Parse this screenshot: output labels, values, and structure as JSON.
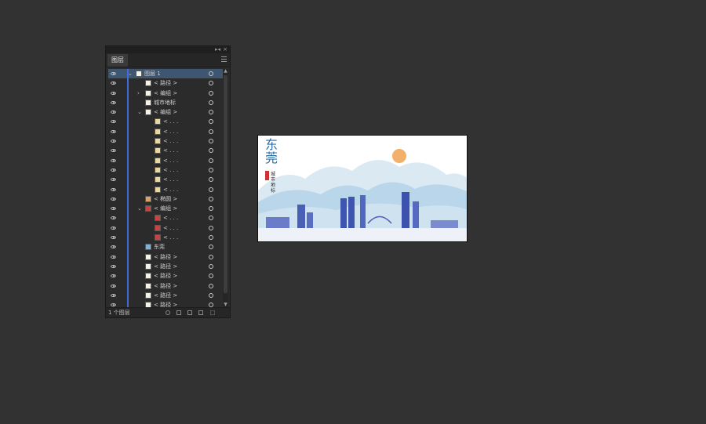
{
  "panel": {
    "tab_label": "图层",
    "collapse_glyph": "▸◂",
    "close_glyph": "×",
    "scroll_up_glyph": "▲",
    "scroll_down_glyph": "▼",
    "footer_count": "1 个图层",
    "rows": [
      {
        "label": "图层 1",
        "twist": "⌄",
        "selected": true,
        "thumb": "plain"
      },
      {
        "label": "< 路径 >",
        "twist": "",
        "thumb": "plain"
      },
      {
        "label": "< 编组 >",
        "twist": "›",
        "thumb": "plain"
      },
      {
        "label": "城市地标",
        "twist": "",
        "thumb": "plain"
      },
      {
        "label": "< 编组 >",
        "twist": "⌄",
        "thumb": "plain"
      },
      {
        "label": "< . . .",
        "twist": "",
        "thumb": "gold"
      },
      {
        "label": "< . . .",
        "twist": "",
        "thumb": "gold"
      },
      {
        "label": "< . . .",
        "twist": "",
        "thumb": "gold"
      },
      {
        "label": "< . . .",
        "twist": "",
        "thumb": "gold"
      },
      {
        "label": "< . . .",
        "twist": "",
        "thumb": "gold"
      },
      {
        "label": "< . . .",
        "twist": "",
        "thumb": "gold"
      },
      {
        "label": "< . . .",
        "twist": "",
        "thumb": "gold"
      },
      {
        "label": "< . . .",
        "twist": "",
        "thumb": "gold"
      },
      {
        "label": "< 椭圆 >",
        "twist": "",
        "thumb": "orn"
      },
      {
        "label": "< 编组 >",
        "twist": "⌄",
        "thumb": "red"
      },
      {
        "label": "< . . .",
        "twist": "",
        "thumb": "red"
      },
      {
        "label": "< . . .",
        "twist": "",
        "thumb": "red"
      },
      {
        "label": "< . . .",
        "twist": "",
        "thumb": "red"
      },
      {
        "label": "东莞",
        "twist": "",
        "thumb": "blue"
      },
      {
        "label": "< 路径 >",
        "twist": "",
        "thumb": "plain"
      },
      {
        "label": "< 路径 >",
        "twist": "",
        "thumb": "plain"
      },
      {
        "label": "< 路径 >",
        "twist": "",
        "thumb": "plain"
      },
      {
        "label": "< 路径 >",
        "twist": "",
        "thumb": "plain"
      },
      {
        "label": "< 路径 >",
        "twist": "",
        "thumb": "plain"
      },
      {
        "label": "< 路径 >",
        "twist": "",
        "thumb": "plain"
      }
    ]
  },
  "artboard": {
    "title": "东莞",
    "subtitle": "城市地标"
  }
}
